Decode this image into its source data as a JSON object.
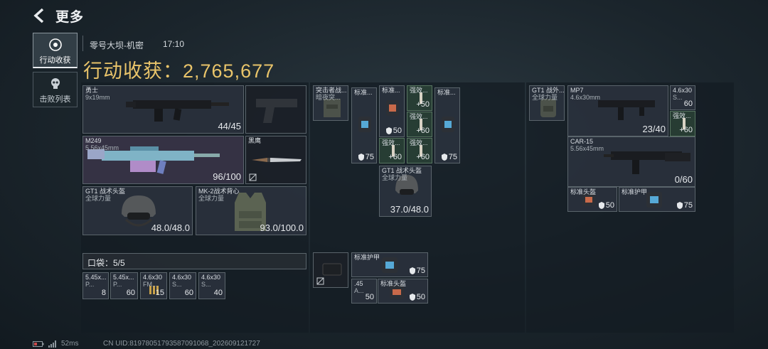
{
  "header": {
    "title": "更多"
  },
  "side_tabs": [
    {
      "label": "行动收获",
      "active": true
    },
    {
      "label": "击败列表",
      "active": false
    }
  ],
  "match": {
    "map": "零号大坝-机密",
    "time": "17:10"
  },
  "gain": {
    "text": "行动收获：2,765,677"
  },
  "loadout": {
    "primary": {
      "name": "勇士",
      "ammo": "9x19mm",
      "count": "44/45"
    },
    "secondary": {
      "name": "M249",
      "ammo": "5.56x45mm",
      "count": "96/100"
    },
    "knife": {
      "name": "黑鹰"
    },
    "helmet": {
      "name": "GT1 战术头盔",
      "brand": "全球力量",
      "durability": "48.0/48.0"
    },
    "vest": {
      "name": "MK-2战术背心",
      "brand": "全球力量",
      "durability": "93.0/100.0"
    }
  },
  "pouch": {
    "label": "口袋：5/5",
    "items": [
      {
        "name": "5.45x...",
        "sub": "P...",
        "count": "8"
      },
      {
        "name": "5.45x...",
        "sub": "P...",
        "count": "60"
      },
      {
        "name": "4.6x30",
        "sub": "FM...",
        "count": "15"
      },
      {
        "name": "4.6x30",
        "sub": "S...",
        "count": "60"
      },
      {
        "name": "4.6x30",
        "sub": "S...",
        "count": "40"
      }
    ]
  },
  "rig": {
    "bag_name": "突击者战...",
    "bag_sub": "暗夜突...",
    "items": [
      {
        "name": "标准...",
        "value": "75"
      },
      {
        "name": "标准...",
        "value": "50"
      },
      {
        "name": "强效...",
        "value": "50"
      },
      {
        "name": "强效...",
        "value": "60"
      },
      {
        "name": "强效...",
        "value": "60"
      },
      {
        "name": "强效...",
        "value": "60"
      },
      {
        "name": "标准...",
        "value": "75"
      }
    ],
    "helmet": {
      "name": "GT1 战术头盔",
      "brand": "全球力量",
      "durability": "37.0/48.0"
    }
  },
  "backpack": {
    "armor1": {
      "name": "标准护甲",
      "value": "75"
    },
    "ammo": {
      "name": ".45",
      "sub": "A...",
      "count": "50"
    },
    "helmet": {
      "name": "标准头盔",
      "value": "50"
    }
  },
  "right": {
    "helmet": {
      "name": "GT1 战外...",
      "brand": "全球力量"
    },
    "mp7": {
      "name": "MP7",
      "ammo": "4.6x30mm",
      "count": "23/40"
    },
    "ammo": {
      "name": "4.6x30",
      "sub": "S...",
      "count": "60"
    },
    "med": {
      "name": "强效...",
      "value": "60"
    },
    "car": {
      "name": "CAR-15",
      "ammo": "5.56x45mm",
      "count": "0/60"
    },
    "helmet2": {
      "name": "标准头盔",
      "value": "50"
    },
    "armor": {
      "name": "标准护甲",
      "value": "75"
    }
  },
  "status": {
    "ping": "52ms",
    "uid": "CN UID:81978051793587091068_202609121727"
  },
  "colors": {
    "gold": "#e9c46a",
    "panel": "#141c22",
    "slot": "#2c323e"
  }
}
